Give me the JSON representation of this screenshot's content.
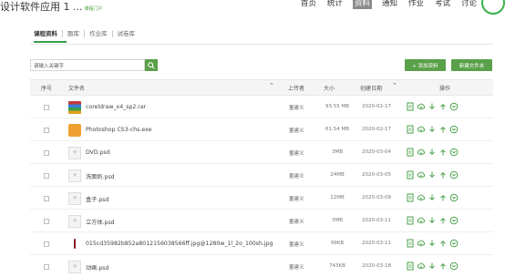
{
  "header": {
    "course_title": "设计软件应用 1 ...",
    "portal_link": "课程门户",
    "nav": [
      "首页",
      "统计",
      "资料",
      "通知",
      "作业",
      "考试",
      "讨论"
    ],
    "active_nav": "资料"
  },
  "subtabs": [
    "课程资料",
    "题库",
    "作业库",
    "试卷库"
  ],
  "search": {
    "placeholder": "请输入关键字"
  },
  "buttons": {
    "add": "+ 添加资料",
    "new_folder": "新建文件夹"
  },
  "table": {
    "columns": {
      "index": "序号",
      "filename": "文件名",
      "uploader": "上传者",
      "size": "大小",
      "created": "创建日期",
      "actions": "操作"
    },
    "rows": [
      {
        "name": "coreldraw_x4_sp2.rar",
        "uploader": "董建义",
        "size": "93.55 MB",
        "date": "2020-02-17",
        "icon": "rar-file-icon"
      },
      {
        "name": "Photoshop CS3-chs.exe",
        "uploader": "董建义",
        "size": "61.54 MB",
        "date": "2020-02-17",
        "icon": "exe-file-icon"
      },
      {
        "name": "DVD.psd",
        "uploader": "董建义",
        "size": "3MB",
        "date": "2020-03-04",
        "icon": "psd-file-icon"
      },
      {
        "name": "洗面奶.psd",
        "uploader": "董建义",
        "size": "24MB",
        "date": "2020-03-05",
        "icon": "psd-file-icon"
      },
      {
        "name": "盒子.psd",
        "uploader": "董建义",
        "size": "12MB",
        "date": "2020-03-09",
        "icon": "psd-file-icon"
      },
      {
        "name": "立方体.psd",
        "uploader": "董建义",
        "size": "3MB",
        "date": "2020-03-11",
        "icon": "psd-file-icon"
      },
      {
        "name": "015cd35982b852a8012156038566ff.jpg@1280w_1l_2o_100sh.jpg",
        "uploader": "董建义",
        "size": "99KB",
        "date": "2020-03-11",
        "icon": "jpg-file-icon"
      },
      {
        "name": "动画.psd",
        "uploader": "董建义",
        "size": "743KB",
        "date": "2020-03-18",
        "icon": "psd-file-icon"
      }
    ]
  },
  "colors": {
    "accent": "#5aa04a",
    "action_icon": "#4aa04a"
  }
}
